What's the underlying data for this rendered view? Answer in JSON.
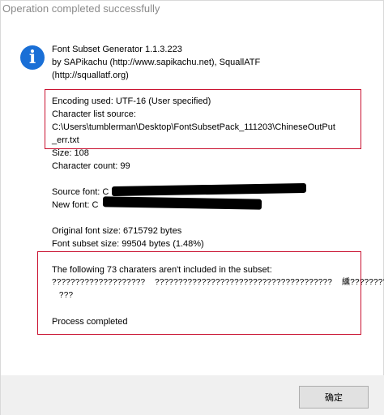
{
  "window": {
    "title": "Operation completed successfully"
  },
  "header": {
    "app_name": "Font Subset Generator 1.1.3.223",
    "authors": "by SAPikachu (http://www.sapikachu.net), SquallATF",
    "author_url": "(http://squallatf.org)"
  },
  "encoding": {
    "encoding_used": "Encoding used: UTF-16 (User specified)",
    "char_list_label": "Character list source:",
    "char_list_path_1": "C:\\Users\\tumblerman\\Desktop\\FontSubsetPack_111203\\ChineseOutPut",
    "char_list_path_2": "_err.txt"
  },
  "stats": {
    "size": "Size: 108",
    "char_count": "Character count: 99"
  },
  "fonts": {
    "source_font": "Source font: C",
    "new_font": "New font: C"
  },
  "sizes": {
    "original": "Original font size: 6715792 bytes",
    "subset": "Font subset size: 99504 bytes (1.48%)"
  },
  "missing": {
    "heading": "The following 73 charaters aren't included in the subset:",
    "line_1": "????????????????????    ??????????????????????????????????????    纁?????????",
    "line_2": "   ???",
    "status": "Process completed"
  },
  "buttons": {
    "ok_label": "确定"
  },
  "colors": {
    "highlight_border": "#c9102f",
    "info_icon": "#1a6fd6",
    "title_text": "#8a8a8a",
    "footer_bg": "#f0f0f0"
  },
  "icons": {
    "info": "info-icon"
  }
}
